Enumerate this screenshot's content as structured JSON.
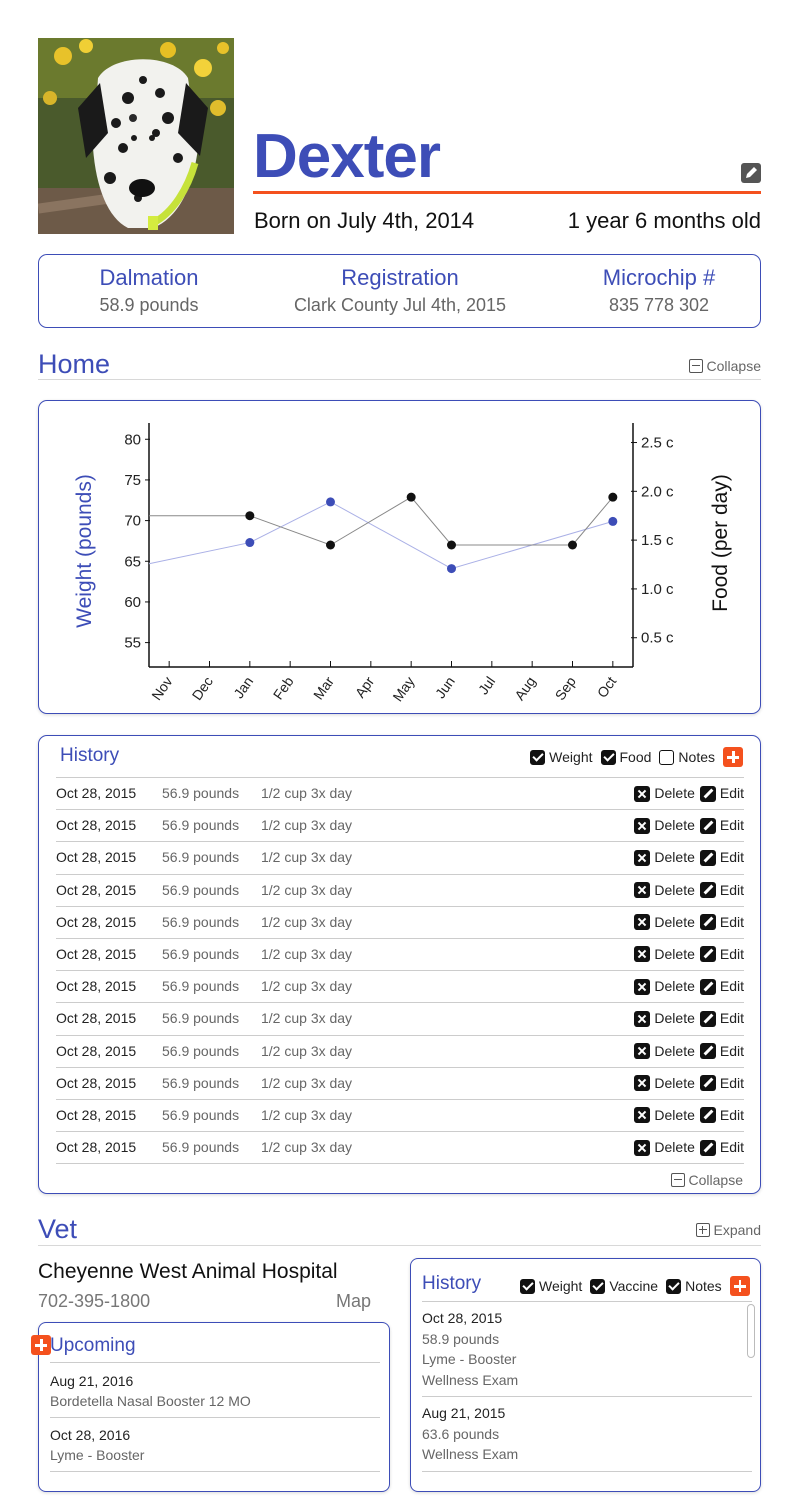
{
  "pet": {
    "name": "Dexter",
    "born": "Born on July 4th, 2014",
    "age": "1 year 6 months old"
  },
  "info": [
    {
      "title": "Dalmation",
      "value": "58.9 pounds"
    },
    {
      "title": "Registration",
      "value": "Clark County Jul 4th, 2015"
    },
    {
      "title": "Microchip #",
      "value": "835 778 302"
    }
  ],
  "home": {
    "title": "Home",
    "toggle_label": "Collapse"
  },
  "chart_data": {
    "type": "line",
    "categories": [
      "Nov",
      "Dec",
      "Jan",
      "Feb",
      "Mar",
      "Apr",
      "May",
      "Jun",
      "Jul",
      "Aug",
      "Sep",
      "Oct"
    ],
    "ylabel_left": "Weight (pounds)",
    "ylabel_right": "Food (per day)",
    "y_left_ticks": [
      "80",
      "75",
      "70",
      "65",
      "60",
      "55"
    ],
    "y_right_ticks": [
      "2.5 c",
      "2.0 c",
      "1.5 c",
      "1.0 c",
      "0.5 c"
    ],
    "y_left_range": [
      52,
      82
    ],
    "y_right_range": [
      0.2,
      2.7
    ],
    "series": [
      {
        "axis": "left",
        "color": "#3d4db7",
        "points": [
          {
            "x": "Nov",
            "y": 64.7,
            "marker": false
          },
          {
            "x": "Jan",
            "y": 67.3,
            "marker": true
          },
          {
            "x": "Mar",
            "y": 72.3,
            "marker": true
          },
          {
            "x": "Jun",
            "y": 64.1,
            "marker": true
          },
          {
            "x": "Oct",
            "y": 69.9,
            "marker": true
          }
        ]
      },
      {
        "axis": "right",
        "color": "#111111",
        "points": [
          {
            "x": "Nov",
            "y": 1.75,
            "marker": false
          },
          {
            "x": "Jan",
            "y": 1.75,
            "marker": true
          },
          {
            "x": "Mar",
            "y": 1.45,
            "marker": true
          },
          {
            "x": "May",
            "y": 1.94,
            "marker": true
          },
          {
            "x": "Jun",
            "y": 1.45,
            "marker": true
          },
          {
            "x": "Sep",
            "y": 1.45,
            "marker": true
          },
          {
            "x": "Oct",
            "y": 1.94,
            "marker": true
          }
        ]
      }
    ]
  },
  "history": {
    "title": "History",
    "filters": [
      {
        "label": "Weight",
        "checked": true
      },
      {
        "label": "Food",
        "checked": true
      },
      {
        "label": "Notes",
        "checked": false
      }
    ],
    "delete_label": "Delete",
    "edit_label": "Edit",
    "collapse_label": "Collapse",
    "rows": [
      {
        "date": "Oct 28, 2015",
        "weight": "56.9 pounds",
        "food": "1/2 cup 3x day"
      },
      {
        "date": "Oct 28, 2015",
        "weight": "56.9 pounds",
        "food": "1/2 cup 3x day"
      },
      {
        "date": "Oct 28, 2015",
        "weight": "56.9 pounds",
        "food": "1/2 cup 3x day"
      },
      {
        "date": "Oct 28, 2015",
        "weight": "56.9 pounds",
        "food": "1/2 cup 3x day"
      },
      {
        "date": "Oct 28, 2015",
        "weight": "56.9 pounds",
        "food": "1/2 cup 3x day"
      },
      {
        "date": "Oct 28, 2015",
        "weight": "56.9 pounds",
        "food": "1/2 cup 3x day"
      },
      {
        "date": "Oct 28, 2015",
        "weight": "56.9 pounds",
        "food": "1/2 cup 3x day"
      },
      {
        "date": "Oct 28, 2015",
        "weight": "56.9 pounds",
        "food": "1/2 cup 3x day"
      },
      {
        "date": "Oct 28, 2015",
        "weight": "56.9 pounds",
        "food": "1/2 cup 3x day"
      },
      {
        "date": "Oct 28, 2015",
        "weight": "56.9 pounds",
        "food": "1/2 cup 3x day"
      },
      {
        "date": "Oct 28, 2015",
        "weight": "56.9 pounds",
        "food": "1/2 cup 3x day"
      },
      {
        "date": "Oct 28, 2015",
        "weight": "56.9 pounds",
        "food": "1/2 cup 3x day"
      }
    ]
  },
  "vet": {
    "title": "Vet",
    "toggle_label": "Expand",
    "name": "Cheyenne West Animal Hospital",
    "phone": "702-395-1800",
    "map_label": "Map",
    "upcoming": {
      "title": "Upcoming",
      "items": [
        {
          "date": "Aug 21, 2016",
          "lines": [
            "Bordetella Nasal Booster 12 MO"
          ]
        },
        {
          "date": "Oct 28, 2016",
          "lines": [
            "Lyme - Booster"
          ]
        }
      ]
    },
    "history": {
      "title": "History",
      "filters": [
        {
          "label": "Weight",
          "checked": true
        },
        {
          "label": "Vaccine",
          "checked": true
        },
        {
          "label": "Notes",
          "checked": true
        }
      ],
      "items": [
        {
          "date": "Oct 28, 2015",
          "lines": [
            "58.9 pounds",
            "Lyme - Booster",
            "Wellness Exam"
          ]
        },
        {
          "date": "Aug 21, 2015",
          "lines": [
            "63.6 pounds",
            "Wellness Exam"
          ]
        }
      ]
    }
  }
}
